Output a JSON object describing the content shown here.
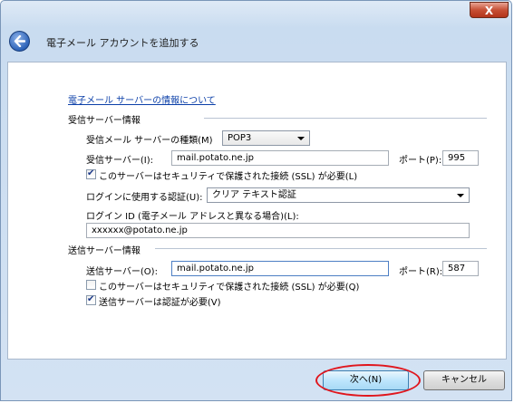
{
  "window": {
    "close_label": "X",
    "title": "電子メール アカウントを追加する"
  },
  "main": {
    "info_link": "電子メール サーバーの情報について",
    "incoming": {
      "section_label": "受信サーバー情報",
      "type_label": "受信メール サーバーの種類(M)",
      "type_value": "POP3",
      "server_label": "受信サーバー(I):",
      "server_value": "mail.potato.ne.jp",
      "port_label": "ポート(P):",
      "port_value": "995",
      "ssl_label": "このサーバーはセキュリティで保護された接続 (SSL) が必要(L)",
      "ssl_checked": true,
      "auth_label": "ログインに使用する認証(U):",
      "auth_value": "クリア テキスト認証",
      "login_label": "ログイン ID (電子メール アドレスと異なる場合)(L):",
      "login_value": "xxxxxx@potato.ne.jp"
    },
    "outgoing": {
      "section_label": "送信サーバー情報",
      "server_label": "送信サーバー(O):",
      "server_value": "mail.potato.ne.jp",
      "port_label": "ポート(R):",
      "port_value": "587",
      "ssl_label": "このサーバーはセキュリティで保護された接続 (SSL) が必要(Q)",
      "ssl_checked": false,
      "auth_label": "送信サーバーは認証が必要(V)",
      "auth_checked": true
    }
  },
  "footer": {
    "next_label": "次へ(N)",
    "cancel_label": "キャンセル"
  },
  "colors": {
    "highlight": "#e0161d",
    "link": "#0b3fa8"
  }
}
